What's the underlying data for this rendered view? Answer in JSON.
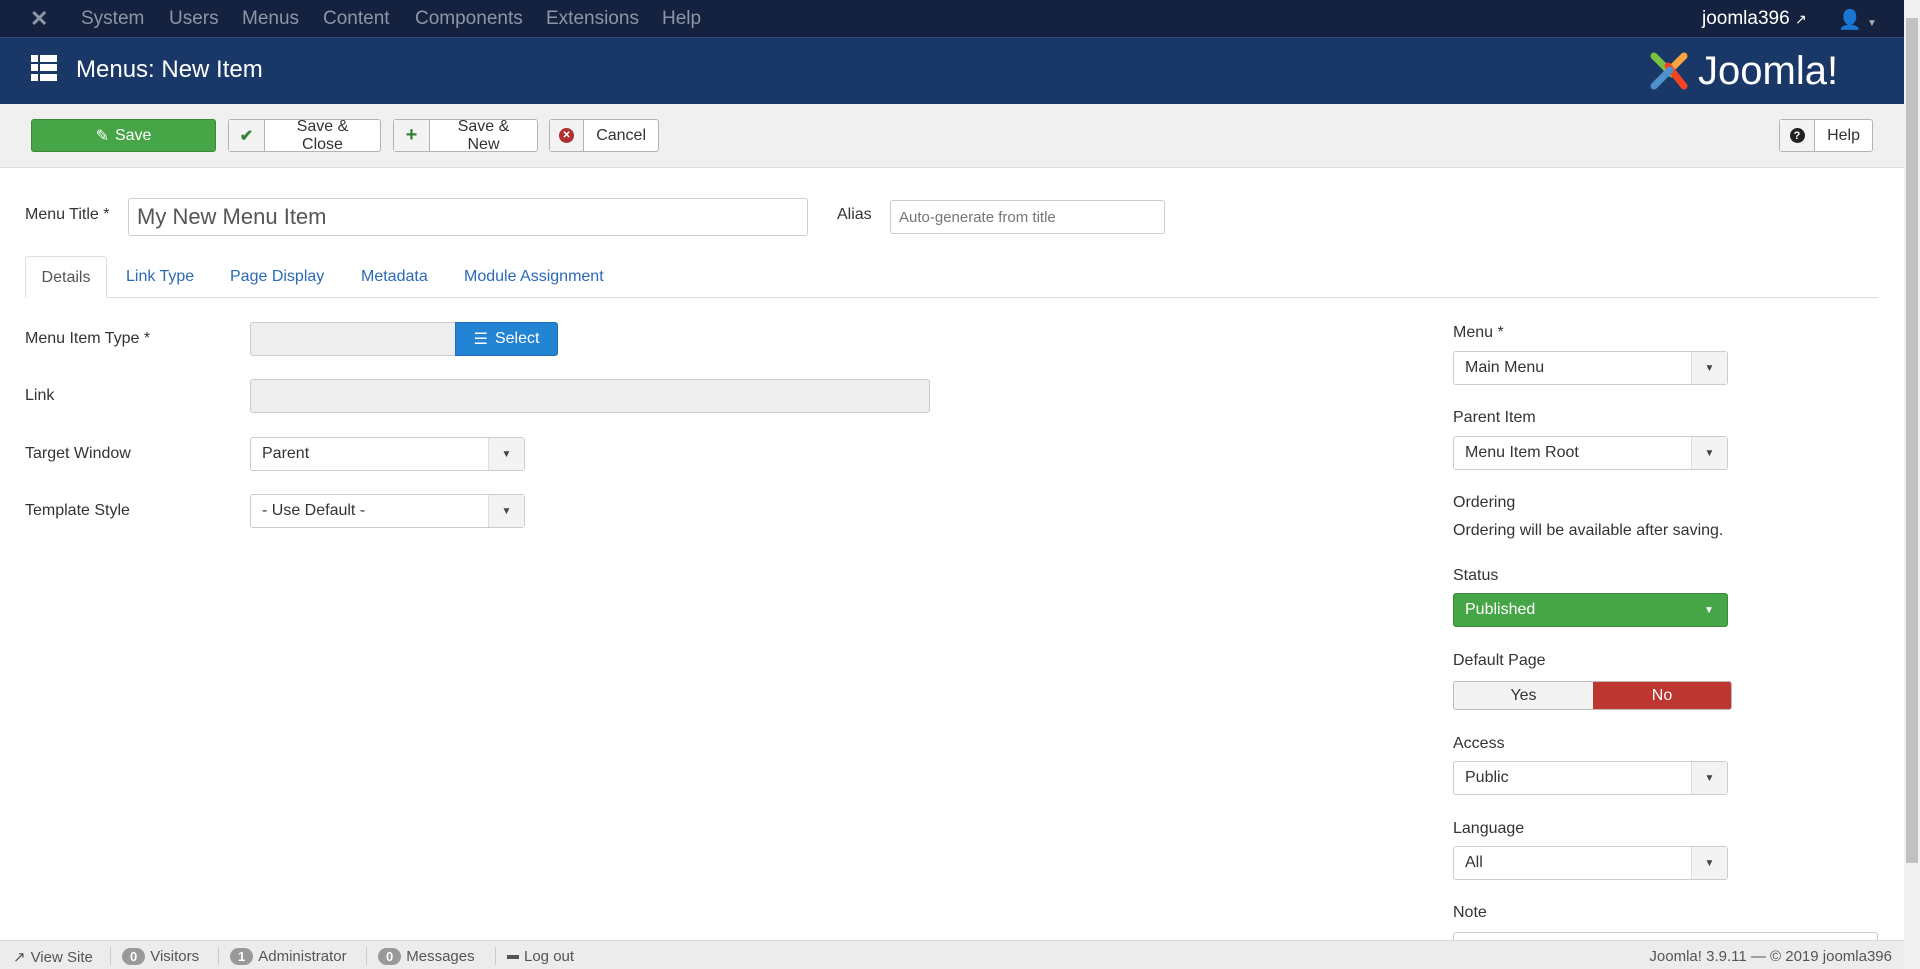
{
  "topnav": {
    "menu": [
      "System",
      "Users",
      "Menus",
      "Content",
      "Components",
      "Extensions",
      "Help"
    ],
    "site_link": "joomla396"
  },
  "header": {
    "title": "Menus: New Item",
    "logo_text": "Joomla!"
  },
  "toolbar": {
    "save": "Save",
    "save_close": "Save & Close",
    "save_new": "Save & New",
    "cancel": "Cancel",
    "help": "Help"
  },
  "form": {
    "title_label": "Menu Title *",
    "title_value": "My New Menu Item",
    "alias_label": "Alias",
    "alias_placeholder": "Auto-generate from title",
    "tabs": [
      "Details",
      "Link Type",
      "Page Display",
      "Metadata",
      "Module Assignment"
    ],
    "menu_item_type_label": "Menu Item Type *",
    "select_button": "Select",
    "link_label": "Link",
    "target_window_label": "Target Window",
    "target_window_value": "Parent",
    "template_style_label": "Template Style",
    "template_style_value": "- Use Default -"
  },
  "side": {
    "menu_label": "Menu *",
    "menu_value": "Main Menu",
    "parent_label": "Parent Item",
    "parent_value": "Menu Item Root",
    "ordering_label": "Ordering",
    "ordering_text": "Ordering will be available after saving.",
    "status_label": "Status",
    "status_value": "Published",
    "default_label": "Default Page",
    "default_yes": "Yes",
    "default_no": "No",
    "access_label": "Access",
    "access_value": "Public",
    "language_label": "Language",
    "language_value": "All",
    "note_label": "Note"
  },
  "footer": {
    "view_site": "View Site",
    "visitors_count": "0",
    "visitors": "Visitors",
    "admin_count": "1",
    "admin": "Administrator",
    "messages_count": "0",
    "messages": "Messages",
    "logout": "Log out",
    "version": "Joomla! 3.9.11  —  © 2019 joomla396"
  },
  "colors": {
    "topnav": "#14223f",
    "header": "#1a3867",
    "save": "#46a546",
    "select": "#2384d3",
    "no": "#bd362f"
  }
}
